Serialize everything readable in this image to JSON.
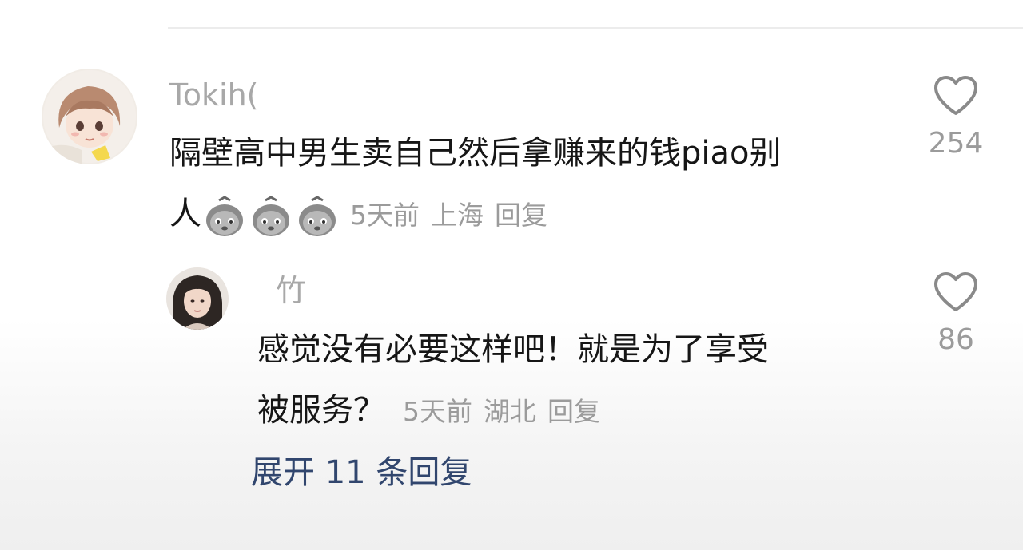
{
  "comment": {
    "username": "Tokih(",
    "text_line1": "隔壁高中男生卖自己然后拿赚来的钱piao别",
    "text_line2": "人",
    "emojis": [
      "face-icon",
      "face-icon",
      "face-icon"
    ],
    "time": "5天前",
    "location": "上海",
    "reply_label": "回复",
    "likes": "254"
  },
  "reply": {
    "username": "竹",
    "text_line1": "感觉没有必要这样吧！就是为了享受",
    "text_line2": "被服务？",
    "time": "5天前",
    "location": "湖北",
    "reply_label": "回复",
    "likes": "86"
  },
  "expand_label": "展开 11 条回复",
  "colors": {
    "username": "#a8a8a8",
    "text": "#161616",
    "meta": "#9b9b9b",
    "link": "#31466e"
  }
}
